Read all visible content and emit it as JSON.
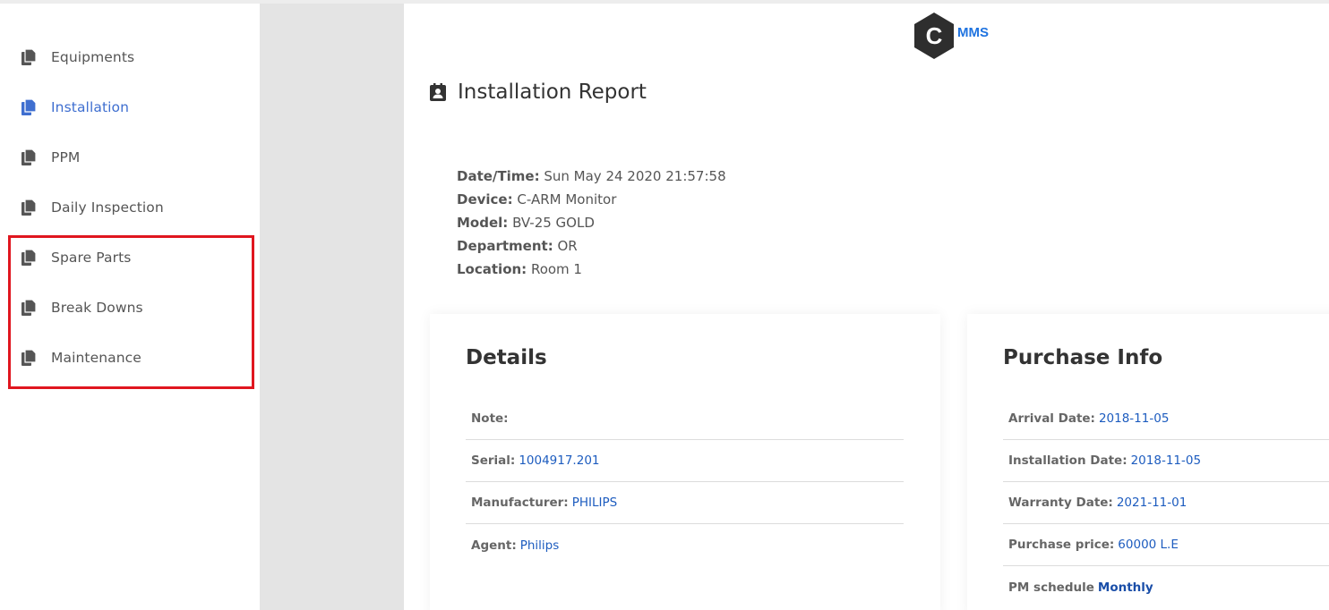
{
  "sidebar": {
    "items": [
      {
        "label": "Equipments"
      },
      {
        "label": "Installation"
      },
      {
        "label": "PPM"
      },
      {
        "label": "Daily Inspection"
      },
      {
        "label": "Spare Parts"
      },
      {
        "label": "Break Downs"
      },
      {
        "label": "Maintenance"
      }
    ],
    "active_index": 1
  },
  "logo": {
    "letter": "C",
    "text": "MMS"
  },
  "report": {
    "title": "Installation Report",
    "meta": [
      {
        "key": "Date/Time:",
        "value": "Sun May 24 2020 21:57:58"
      },
      {
        "key": "Device:",
        "value": "C-ARM Monitor"
      },
      {
        "key": "Model:",
        "value": "BV-25 GOLD"
      },
      {
        "key": "Department:",
        "value": "OR"
      },
      {
        "key": "Location:",
        "value": "Room 1"
      }
    ]
  },
  "details": {
    "title": "Details",
    "rows": [
      {
        "key": "Note:",
        "value": ""
      },
      {
        "key": "Serial:",
        "value": "1004917.201"
      },
      {
        "key": "Manufacturer:",
        "value": "PHILIPS"
      },
      {
        "key": "Agent:",
        "value": "Philips"
      }
    ]
  },
  "purchase": {
    "title": "Purchase Info",
    "rows": [
      {
        "key": "Arrival Date:",
        "value": "2018-11-05"
      },
      {
        "key": "Installation Date:",
        "value": "2018-11-05"
      },
      {
        "key": "Warranty Date:",
        "value": "2021-11-01"
      },
      {
        "key": "Purchase price:",
        "value": "60000 L.E"
      },
      {
        "key": "PM schedule",
        "value": "Monthly"
      }
    ]
  },
  "colors": {
    "accent": "#3f6fd0",
    "link": "#1d5cbf",
    "logo_blue": "#1f73e0",
    "highlight": "#e0161f",
    "gutter": "#e4e4e4"
  },
  "icons": {
    "nav": "copy-icon",
    "report": "contact-badge-icon",
    "logo": "hexagon-logo"
  }
}
